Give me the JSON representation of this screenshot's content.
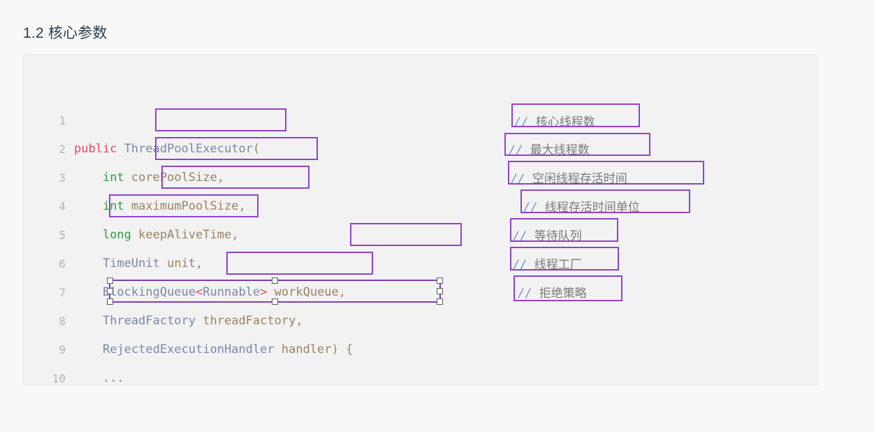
{
  "page": {
    "title": "1.2 核心参数",
    "background_color": "#f8f8f8"
  },
  "code_block": {
    "background_color": "#f2f2f2",
    "border_color": "#e6e6e6",
    "language": "java",
    "lines": [
      {
        "number": "1",
        "text": "public ThreadPoolExecutor("
      },
      {
        "number": "2",
        "text": "    int corePoolSize,"
      },
      {
        "number": "3",
        "text": "    int maximumPoolSize,"
      },
      {
        "number": "4",
        "text": "    long keepAliveTime,"
      },
      {
        "number": "5",
        "text": "    TimeUnit unit,"
      },
      {
        "number": "6",
        "text": "    BlockingQueue<Runnable> workQueue,"
      },
      {
        "number": "7",
        "text": "    ThreadFactory threadFactory,"
      },
      {
        "number": "8",
        "text": "    RejectedExecutionHandler handler) {"
      },
      {
        "number": "9",
        "text": "    ..."
      },
      {
        "number": "10",
        "text": "}"
      }
    ]
  },
  "comments": [
    {
      "slashes": "//",
      "text": "核心线程数"
    },
    {
      "slashes": "//",
      "text": "最大线程数"
    },
    {
      "slashes": "//",
      "text": "空闲线程存活时间"
    },
    {
      "slashes": "//",
      "text": "线程存活时间单位"
    },
    {
      "slashes": "//",
      "text": "等待队列"
    },
    {
      "slashes": "//",
      "text": "线程工厂"
    },
    {
      "slashes": "//",
      "text": "拒绝策略"
    }
  ],
  "annotations": {
    "stroke_color": "#8e44c8",
    "selected_index": 7,
    "selected_label": "RejectedExecutionHandler handler"
  }
}
